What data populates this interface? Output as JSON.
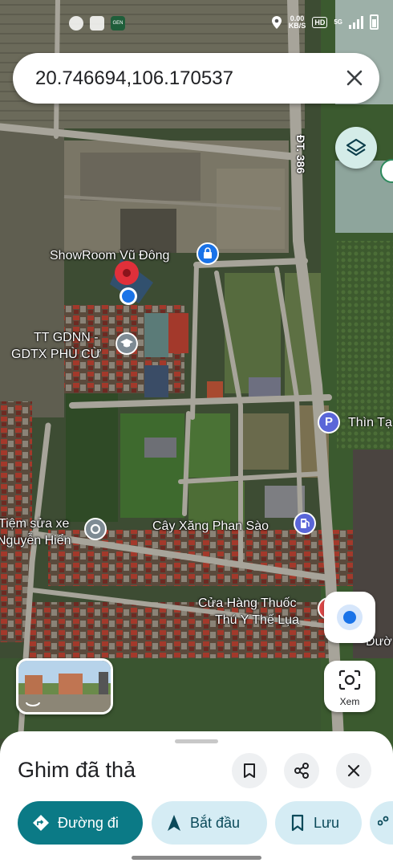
{
  "status_bar": {
    "speed_value": "0.00",
    "speed_unit": "KB/S",
    "network_badge": "HD",
    "signal_label": "5G",
    "app_icon_label": "GEN"
  },
  "search": {
    "query": "20.746694,106.170537"
  },
  "map": {
    "road_label": "ĐT. 386",
    "places": [
      {
        "name": "ShowRoom Vũ Đông"
      },
      {
        "name_line1": "TT GDNN -",
        "name_line2": "GDTX PHÙ CỪ"
      },
      {
        "name": "Thìn Tạ"
      },
      {
        "name_line1": "Tiệm sửa xe",
        "name_line2": "Nguyễn Hiển"
      },
      {
        "name": "Cây Xăng Phan Sào"
      },
      {
        "name_line1": "Cửa Hàng Thuốc",
        "name_line2": "Thú Y Thế Lụa"
      },
      {
        "name": "Đườ"
      }
    ],
    "parking_glyph": "P"
  },
  "lens_button": {
    "label": "Xem"
  },
  "sheet": {
    "title": "Ghim đã thả",
    "chips": [
      {
        "label": "Đường đi",
        "icon": "directions-icon"
      },
      {
        "label": "Bắt đầu",
        "icon": "navigation-arrow-icon"
      },
      {
        "label": "Lưu",
        "icon": "bookmark-icon"
      }
    ]
  },
  "colors": {
    "accent_teal": "#0b7a86",
    "chip_bg": "#d5ecf4",
    "pin_red": "#e0303a",
    "location_blue": "#1a73e8"
  }
}
